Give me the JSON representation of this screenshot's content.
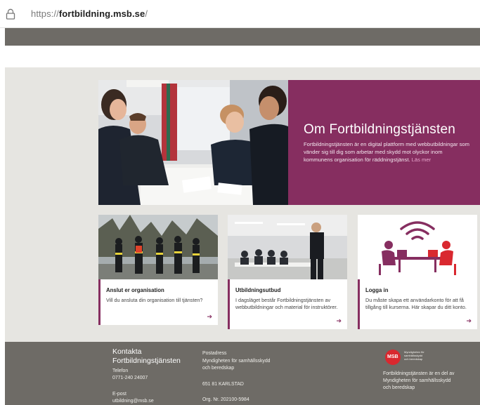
{
  "browser": {
    "url_prefix": "https://",
    "url_host": "fortbildning.msb.se",
    "url_suffix": "/"
  },
  "hero": {
    "title": "Om Fortbildningstjänsten",
    "text": "Fortbildningstjänsten är en digital plattform med webbutbildningar som vänder sig till dig som arbetar med skydd mot olyckor inom kommunens organisation för räddningstjänst.",
    "more_link": "Läs mer"
  },
  "cards": [
    {
      "title": "Anslut er organisation",
      "text": "Vill du ansluta din organisation till tjänsten?",
      "arrow": "➔"
    },
    {
      "title": "Utbildningsutbud",
      "text": "I dagsläget består Fortbildningstjänsten av webbutbildningar och material för instruktörer.",
      "arrow": "➔"
    },
    {
      "title": "Logga in",
      "text": "Du måste skapa ett användarkonto för att få tillgång till kurserna. Här skapar du ditt konto.",
      "arrow": "➔"
    }
  ],
  "footer": {
    "heading_line1": "Kontakta",
    "heading_line2": "Fortbildningstjänsten",
    "phone_label": "Telefon",
    "phone": "0771-240 24007",
    "email_label": "E-post",
    "email": "utbildning@msb.se",
    "address_label": "Postadress",
    "address_line1": "Myndigheten för samhällsskydd",
    "address_line2": "och beredskap",
    "postcode": "651 81 KARLSTAD",
    "org_nr": "Org. Nr. 202100-5984",
    "logo_text": "MSB",
    "logo_subtext_1": "Myndigheten för",
    "logo_subtext_2": "samhällsskydd",
    "logo_subtext_3": "och beredskap",
    "about_line1": "Fortbildningstjänsten är en del av",
    "about_line2": "Myndigheten för samhällsskydd",
    "about_line3": "och beredskap"
  },
  "colors": {
    "brand": "#862e60",
    "footer_bg": "#6e6b66",
    "page_bg": "#e6e5e1",
    "msb_red": "#d9282f"
  }
}
